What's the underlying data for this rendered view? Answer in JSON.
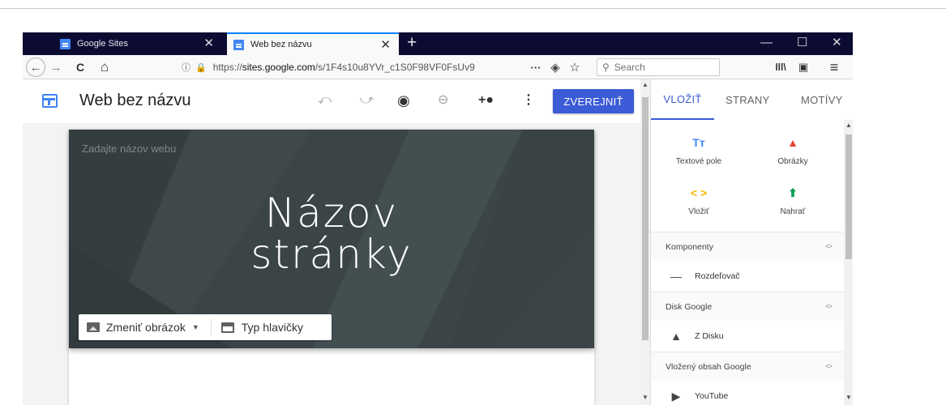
{
  "browser": {
    "tabs": [
      {
        "title": "Google Sites",
        "active": false
      },
      {
        "title": "Web bez názvu",
        "active": true
      }
    ],
    "new_tab": "+",
    "window_controls": {
      "minimize": "—",
      "maximize": "☐",
      "close": "✕"
    },
    "url": {
      "scheme": "https://",
      "host": "sites.google.com",
      "path": "/s/1F4s10u8YVr_c1S0F98VF0FsUv9",
      "fade": ""
    },
    "search_placeholder": "Search",
    "nav": {
      "back": "←",
      "forward": "→",
      "reload": "C",
      "home": "⌂",
      "more": "···",
      "pocket": "◈",
      "bookmark": "☆",
      "library": "lll\\",
      "sidebar": "▣",
      "menu": "≡"
    }
  },
  "editor": {
    "site_title": "Web bez názvu",
    "publish_label": "ZVEREJNIŤ",
    "toolbar_icons": [
      "undo-icon",
      "redo-icon",
      "preview-icon",
      "link-icon",
      "add-editors-icon",
      "more-vert-icon"
    ],
    "header": {
      "site_name_placeholder": "Zadajte názov webu",
      "page_title_line1": "Názov",
      "page_title_line2": "stránky",
      "change_image_label": "Zmeniť obrázok",
      "header_type_label": "Typ hlavičky",
      "banner_color": "#3b4548"
    },
    "feedback_icon": "!"
  },
  "side_panel": {
    "tabs": [
      {
        "label": "VLOŽIŤ",
        "active": true
      },
      {
        "label": "STRANY",
        "active": false
      },
      {
        "label": "MOTÍVY",
        "active": false
      }
    ],
    "insert_items": [
      {
        "label": "Textové pole",
        "icon": "Tт",
        "color": "#4285f4"
      },
      {
        "label": "Obrázky",
        "icon": "▲",
        "color": "#ea4335"
      },
      {
        "label": "Vložiť",
        "icon": "< >",
        "color": "#f4b400"
      },
      {
        "label": "Nahrať",
        "icon": "⬆",
        "color": "#0f9d58"
      }
    ],
    "sections": [
      {
        "title": "Komponenty",
        "items": [
          {
            "label": "Rozdeľovač",
            "icon": "divider-icon"
          }
        ]
      },
      {
        "title": "Disk Google",
        "items": [
          {
            "label": "Z Disku",
            "icon": "drive-icon"
          }
        ]
      },
      {
        "title": "Vložený obsah Google",
        "items": [
          {
            "label": "YouTube",
            "icon": "youtube-icon"
          }
        ]
      }
    ],
    "accent_color": "#3c5bd6"
  }
}
